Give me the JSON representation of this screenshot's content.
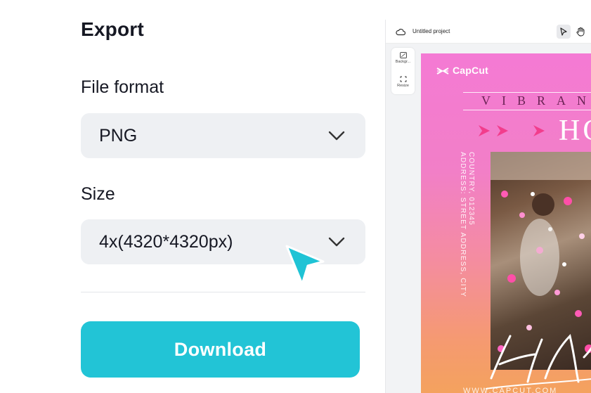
{
  "export": {
    "title": "Export",
    "file_format": {
      "label": "File format",
      "value": "PNG"
    },
    "size": {
      "label": "Size",
      "value": "4x(4320*4320px)"
    },
    "download_label": "Download"
  },
  "editor": {
    "project_name": "Untitled project",
    "tools": [
      {
        "label": "Backgr...",
        "icon": "background-icon"
      },
      {
        "label": "Resize",
        "icon": "resize-icon"
      }
    ],
    "poster": {
      "brand": "CapCut",
      "headline": "VIBRANT",
      "big_text": "HO",
      "address_line1": "ADDRESS: STREET ADDRESS, CITY",
      "address_line2": "COUNTRY, 012345",
      "url": "WWW.CAPCUT.COM"
    }
  },
  "colors": {
    "accent": "#22c4d6",
    "select_bg": "#eef0f3",
    "text": "#161823",
    "cursor": "#1fc3d5",
    "poster_pink": "#f47ad4",
    "poster_orange": "#f4a25e"
  }
}
